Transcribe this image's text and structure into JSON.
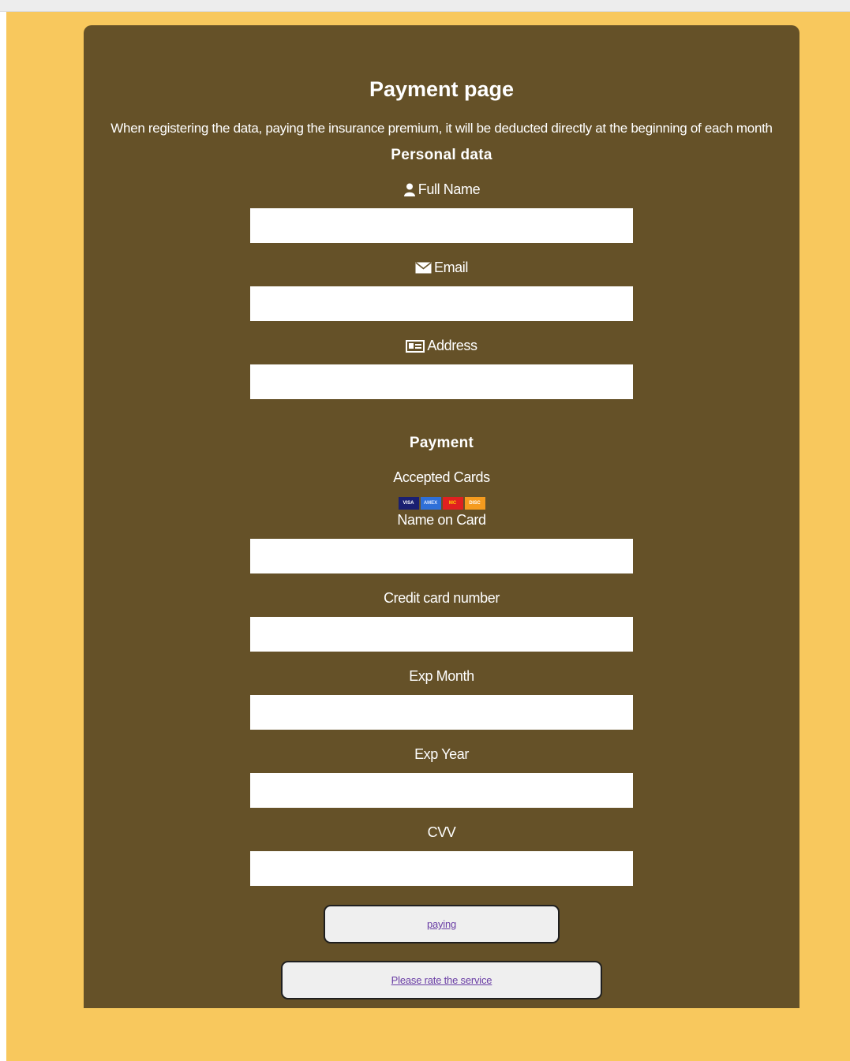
{
  "page": {
    "title": "Payment page",
    "subtitle": "When registering the data, paying the insurance premium, it will be deducted directly at the beginning of each month"
  },
  "personal": {
    "heading": "Personal data",
    "full_name_label": "Full Name",
    "email_label": "Email",
    "address_label": "Address"
  },
  "payment": {
    "heading": "Payment",
    "accepted_cards_label": "Accepted Cards",
    "cards": [
      {
        "name": "VISA",
        "color": "#1a1f71",
        "text_color": "#ffffff"
      },
      {
        "name": "AMEX",
        "color": "#2e6fd8",
        "text_color": "#dbe7ff"
      },
      {
        "name": "MC",
        "color": "#e02020",
        "text_color": "#ffd200"
      },
      {
        "name": "DISC",
        "color": "#f59b1e",
        "text_color": "#ffffff"
      }
    ],
    "name_on_card_label": "Name on Card",
    "card_number_label": "Credit card number",
    "exp_month_label": "Exp Month",
    "exp_year_label": "Exp Year",
    "cvv_label": "CVV"
  },
  "buttons": {
    "pay_label": "paying",
    "rate_label": "Please rate the service"
  },
  "colors": {
    "page_background": "#f8c85d",
    "card_background": "#655128",
    "link": "#6a3ea5"
  }
}
